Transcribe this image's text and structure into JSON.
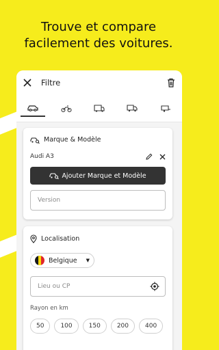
{
  "headline": {
    "line1": "Trouve et compare",
    "line2": "facilement des voitures."
  },
  "topbar": {
    "title": "Filtre",
    "close_icon": "close-icon",
    "delete_icon": "trash-icon"
  },
  "vehicle_tabs": [
    {
      "name": "car",
      "active": true
    },
    {
      "name": "motorbike",
      "active": false
    },
    {
      "name": "camper",
      "active": false
    },
    {
      "name": "truck",
      "active": false
    },
    {
      "name": "trailer",
      "active": false
    }
  ],
  "make_model": {
    "label": "Marque & Modèle",
    "selected": "Audi A3",
    "add_button": "Ajouter Marque et Modèle",
    "version_placeholder": "Version"
  },
  "location": {
    "label": "Localisation",
    "country": "Belgique",
    "city_placeholder": "Lieu ou CP",
    "radius_label": "Rayon en km",
    "radius_options": [
      "50",
      "100",
      "150",
      "200",
      "400"
    ]
  },
  "colors": {
    "accent": "#f6ec1c",
    "button": "#333333"
  }
}
